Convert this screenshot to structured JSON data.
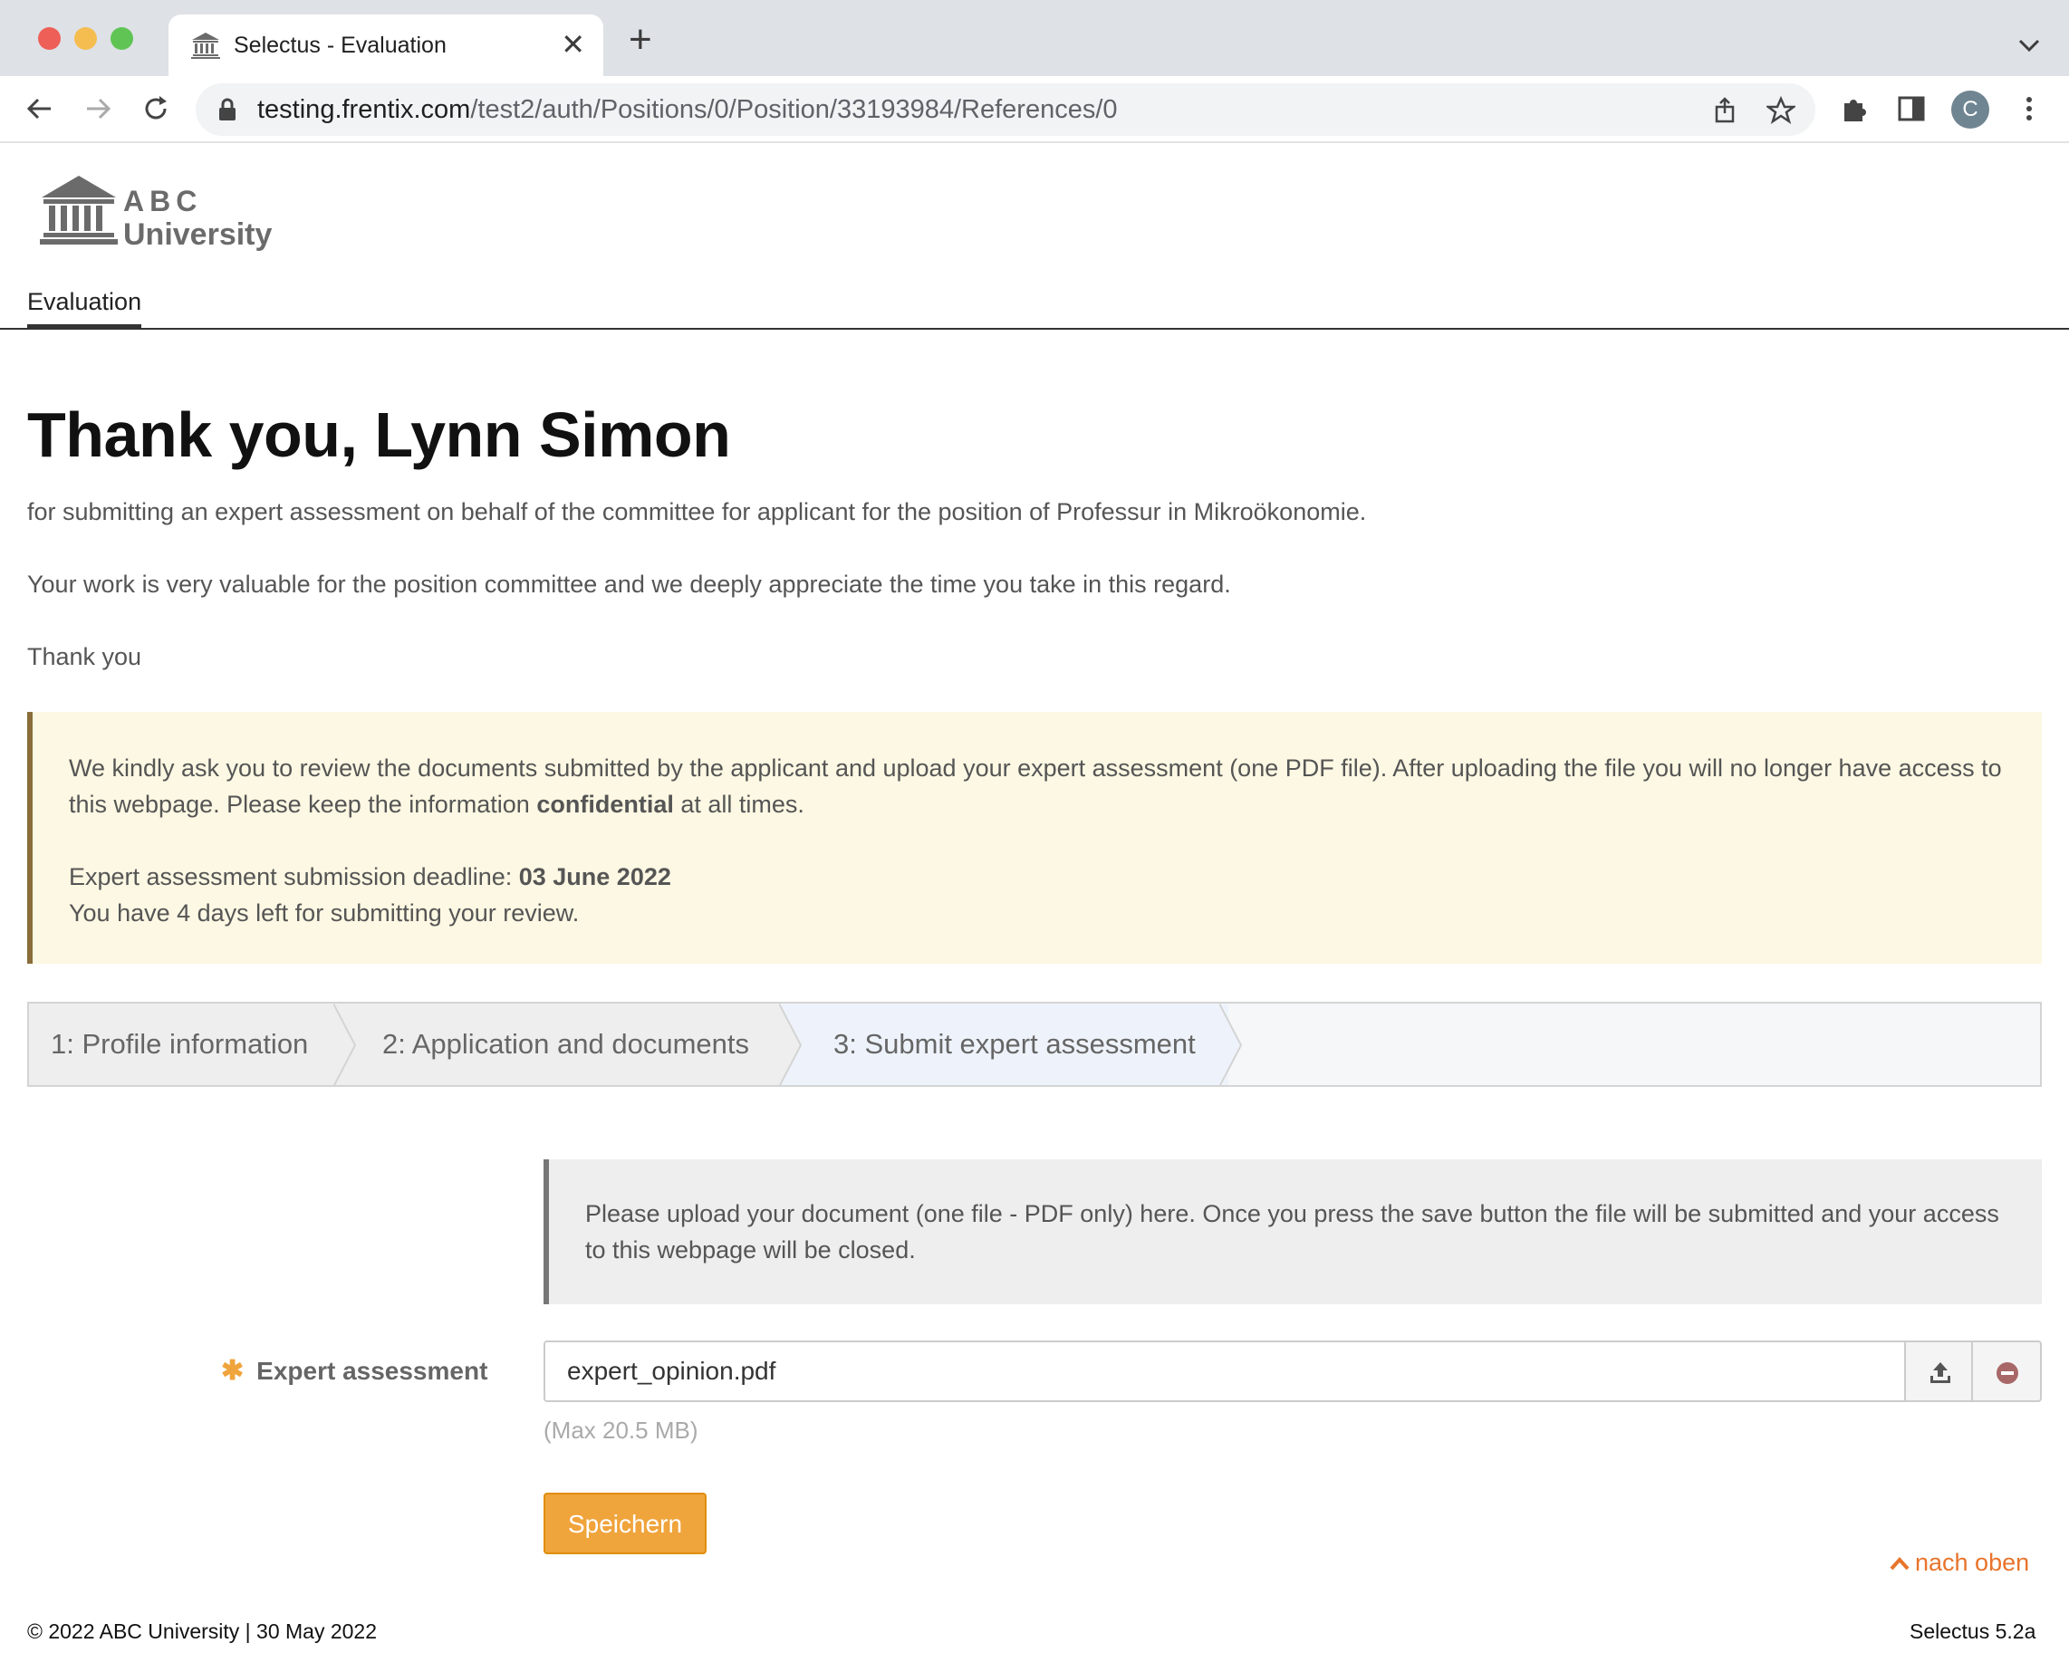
{
  "browser": {
    "tab_title": "Selectus - Evaluation",
    "tab_close": "✕",
    "new_tab": "+",
    "url_host": "testing.frentix.com",
    "url_path": "/test2/auth/Positions/0/Position/33193984/References/0",
    "avatar_letter": "C",
    "icons": [
      "back-arrow-icon",
      "forward-arrow-icon",
      "reload-icon",
      "lock-icon",
      "share-icon",
      "star-icon",
      "extensions-icon",
      "side-panel-icon",
      "kebab-menu-icon",
      "tab-search-chevron-icon"
    ]
  },
  "header": {
    "logo_line1": "ABC",
    "logo_line2": "University",
    "nav_tab": "Evaluation"
  },
  "main": {
    "title": "Thank you, Lynn Simon",
    "para1": "for submitting an expert assessment on behalf of the committee for applicant for the position of Professur in Mikroökonomie.",
    "para2": "Your work is very valuable for the position committee and we deeply appreciate the time you take in this regard.",
    "para3": "Thank you"
  },
  "notice": {
    "text_before": "We kindly ask you to review the documents submitted by the applicant and upload your expert assessment (one PDF file). After uploading the file you will no longer have access to this webpage. Please keep the information ",
    "text_bold": "confidential",
    "text_after": " at all times.",
    "deadline_label": "Expert assessment submission deadline: ",
    "deadline_value": "03 June 2022",
    "days_left": "You have 4 days left for submitting your review."
  },
  "steps": [
    {
      "label": "1: Profile information"
    },
    {
      "label": "2: Application and documents"
    },
    {
      "label": "3: Submit expert assessment",
      "active": true
    }
  ],
  "upload": {
    "info": "Please upload your document (one file - PDF only) here. Once you press the save button the file will be submitted and your access to this webpage will be closed.",
    "field_label": "Expert assessment",
    "required_mark": "✱",
    "file_name": "expert_opinion.pdf",
    "hint": "(Max 20.5 MB)",
    "save_label": "Speichern"
  },
  "footer": {
    "to_top": "nach oben",
    "copyright": "© 2022 ABC University | 30 May 2022",
    "version": "Selectus 5.2a"
  },
  "colors": {
    "accent_orange": "#f0a43c",
    "link_orange": "#e8742c",
    "notice_bg": "#fcf8e3",
    "notice_border": "#8a6d3b"
  }
}
